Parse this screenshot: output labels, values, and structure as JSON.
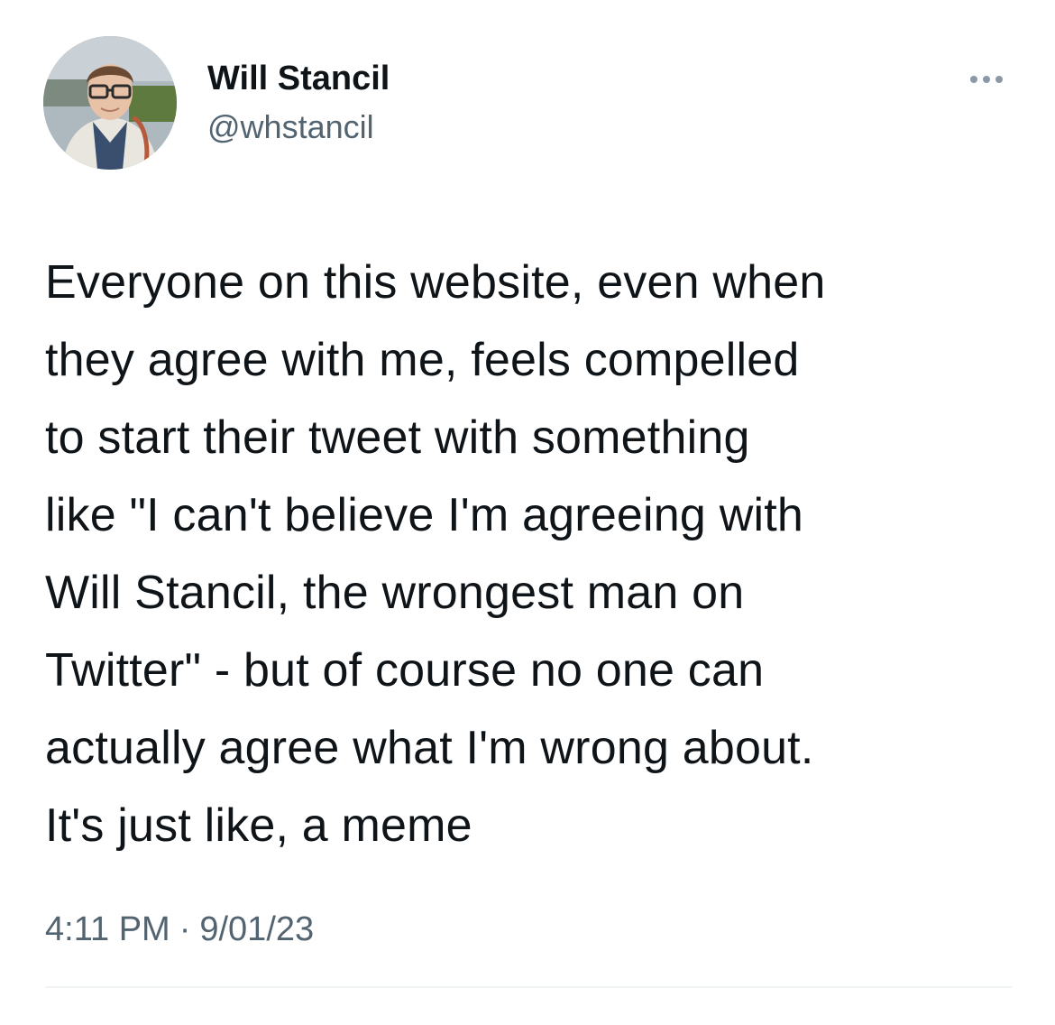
{
  "author": {
    "display_name": "Will Stancil",
    "handle": "@whstancil"
  },
  "tweet": {
    "text": "Everyone on this website, even when\nthey agree with me, feels compelled\nto start their tweet with something\nlike \"I can't believe I'm agreeing with\nWill Stancil, the wrongest man on\nTwitter\" - but of course no one can\nactually agree what I'm wrong about.\nIt's just like, a meme",
    "time": "4:11 PM",
    "separator": "·",
    "date": "9/01/23"
  },
  "icons": {
    "more": "more-icon",
    "avatar": "avatar-photo"
  }
}
